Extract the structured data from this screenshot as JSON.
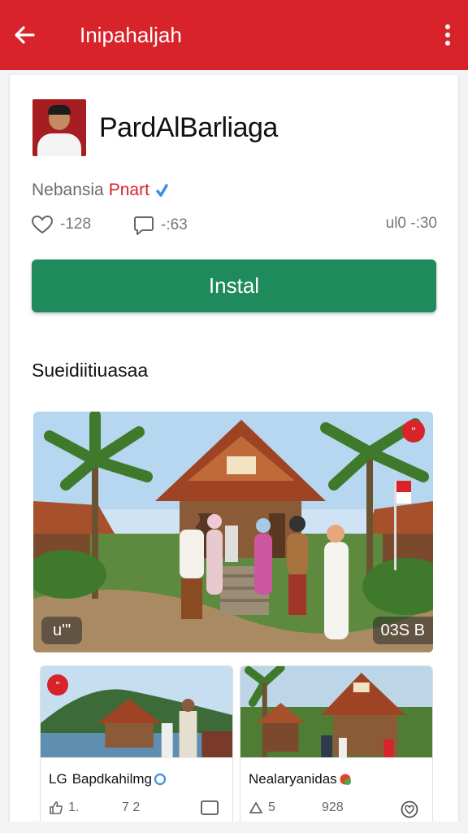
{
  "appbar": {
    "title": "Inipahaljah",
    "color": "#d8232a"
  },
  "profile": {
    "name": "PardAlBarliaga"
  },
  "org": {
    "name": "Nebansia",
    "party": "Pnart"
  },
  "stats": {
    "likes": "-128",
    "comments": "-:63",
    "views": "ul0 -:30"
  },
  "install": {
    "label": "Instal",
    "color": "#1f8a5c"
  },
  "section": {
    "title": "Sueidiitiuasaa"
  },
  "hero": {
    "badge_left": "u'\"",
    "badge_right": "03S B",
    "dot": "\""
  },
  "thumbs": [
    {
      "title": "Bapdkahilmg",
      "prefix": "LG",
      "likes": "1.",
      "count": "7 2",
      "dot": "\""
    },
    {
      "title": "Nealaryanidas",
      "likes": "5",
      "count": "928"
    }
  ]
}
